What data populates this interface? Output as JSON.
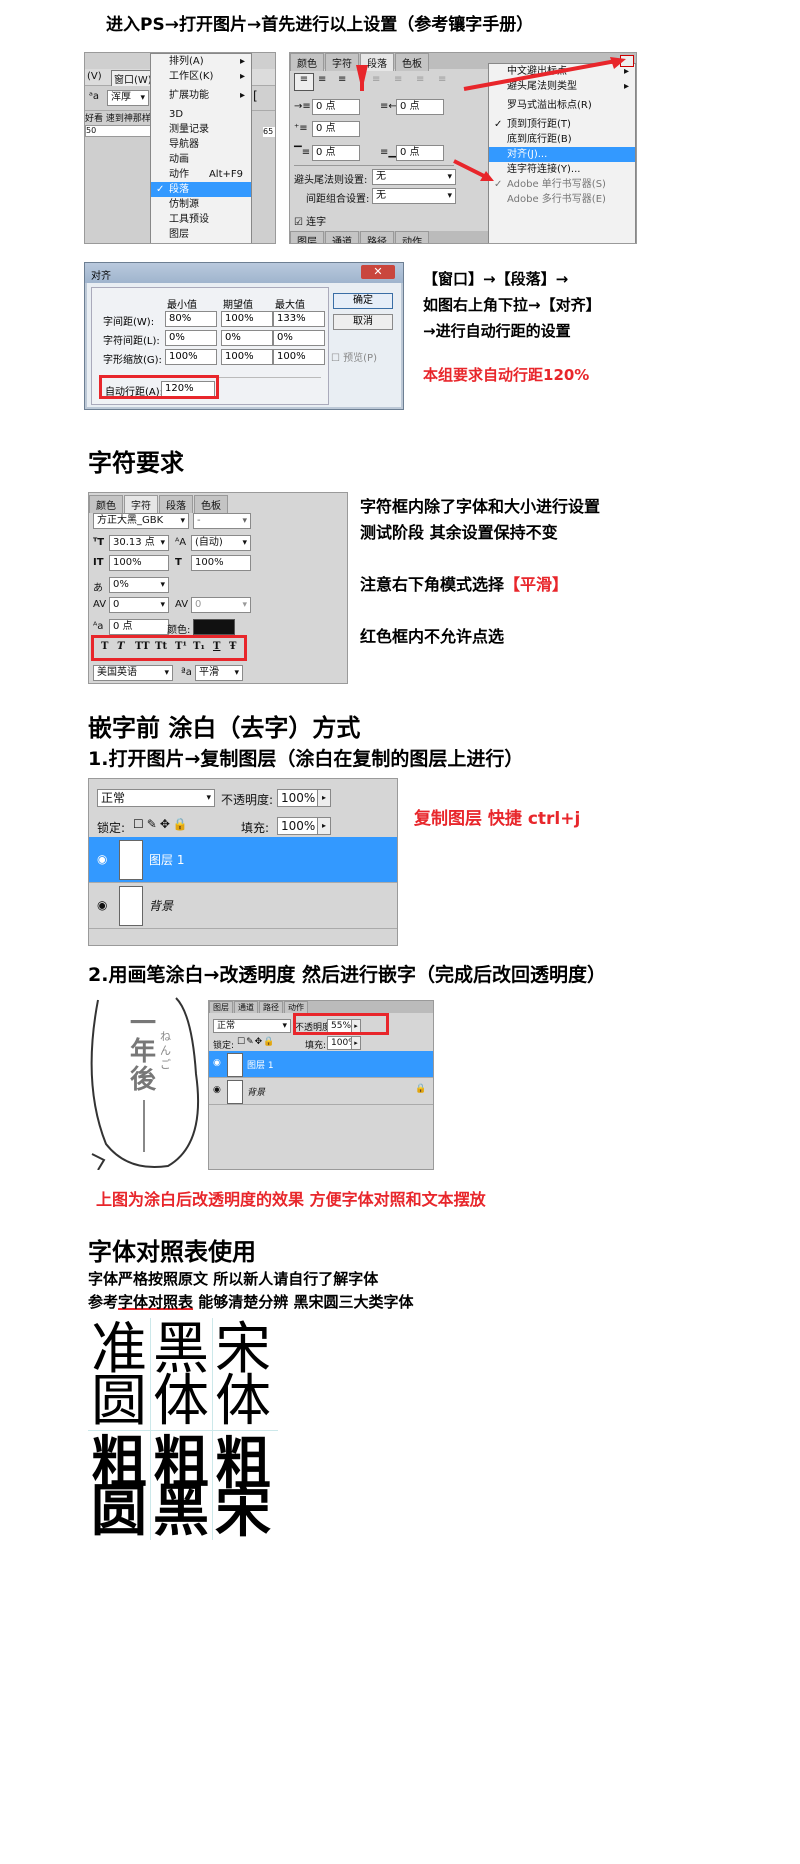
{
  "heading_top": "进入PS→打开图片→首先进行以上设置（参考镶字手册）",
  "ps_window_menu": {
    "menubar": [
      "(V)",
      "窗口(W)"
    ],
    "font_field": "浑厚",
    "ruler_text": "好看 速到神那样",
    "items": [
      {
        "label": "排列(A)",
        "arrow": "▸"
      },
      {
        "label": "工作区(K)",
        "arrow": "▸"
      },
      {
        "label": "扩展功能",
        "arrow": "▸"
      },
      {
        "label": "3D"
      },
      {
        "label": "测量记录"
      },
      {
        "label": "导航器"
      },
      {
        "label": "动画"
      },
      {
        "label": "动作",
        "shortcut": "Alt+F9"
      },
      {
        "label": "段落",
        "check": "✓"
      },
      {
        "label": "仿制源"
      },
      {
        "label": "工具预设"
      },
      {
        "label": "图层"
      }
    ]
  },
  "ps_paragraph_panel": {
    "tabs": [
      "颜色",
      "字符",
      "段落",
      "色板"
    ],
    "fields": [
      "0 点",
      "0 点",
      "0 点",
      "0 点",
      "0 点"
    ],
    "label_punct": "避头尾法则设置:",
    "label_combo": "间距组合设置:",
    "value_none1": "无",
    "value_none2": "无",
    "checkbox": "连字",
    "bottom_tabs": [
      "图层",
      "通道",
      "路径",
      "动作"
    ],
    "menu_items": [
      {
        "label": "中文避出标点",
        "arrow": "▸"
      },
      {
        "label": "避头尾法则类型",
        "arrow": "▸"
      },
      {
        "label": "罗马式溢出标点(R)"
      },
      {
        "label": "顶到顶行距(T)",
        "check": "✓"
      },
      {
        "label": "底到底行距(B)"
      },
      {
        "label": "对齐(J)..."
      },
      {
        "label": "连字符连接(Y)..."
      },
      {
        "label": "Adobe 单行书写器(S)",
        "check": "✓"
      },
      {
        "label": "Adobe 多行书写器(E)"
      }
    ]
  },
  "justify_dialog": {
    "title": "对齐",
    "col_min": "最小值",
    "col_desired": "期望值",
    "col_max": "最大值",
    "rows": [
      {
        "label": "字间距(W):",
        "values": [
          "80%",
          "100%",
          "133%"
        ]
      },
      {
        "label": "字符间距(L):",
        "values": [
          "0%",
          "0%",
          "0%"
        ]
      },
      {
        "label": "字形缩放(G):",
        "values": [
          "100%",
          "100%",
          "100%"
        ]
      }
    ],
    "ok": "确定",
    "cancel": "取消",
    "preview": "预览(P)",
    "auto_leading_label": "自动行距(A):",
    "auto_leading_value": "120%"
  },
  "justify_note": {
    "line1": "【窗口】→【段落】→",
    "line2": "如图右上角下拉→【对齐】",
    "line3": "→进行自动行距的设置",
    "red_line": "本组要求自动行距120%"
  },
  "char_heading": "字符要求",
  "char_panel": {
    "tabs": [
      "颜色",
      "字符",
      "段落",
      "色板"
    ],
    "font": "方正大黑_GBK",
    "style": "-",
    "size": "30.13 点",
    "leading": "(自动)",
    "vscale": "100%",
    "hscale": "100%",
    "tracking": "0%",
    "kern": "0",
    "kern2": "0",
    "baseline": "0 点",
    "color_label": "颜色:",
    "style_buttons": [
      "T",
      "T",
      "TT",
      "Tt",
      "T¹",
      "T₁",
      "T",
      "Ŧ"
    ],
    "language": "美国英语",
    "aa_label": "ªa",
    "aa": "平滑"
  },
  "char_note": {
    "line1": "字符框内除了字体和大小进行设置",
    "line2": "测试阶段 其余设置保持不变",
    "line3_a": "注意右下角模式选择",
    "line3_b": "【平滑】",
    "line4": "红色框内不允许点选"
  },
  "erase_heading": "嵌字前 涂白（去字）方式",
  "step1": "1.打开图片→复制图层（涂白在复制的图层上进行）",
  "layers1": {
    "mode": "正常",
    "opacity_label": "不透明度:",
    "opacity": "100%",
    "lock_label": "锁定:",
    "fill_label": "填充:",
    "fill": "100%",
    "layer1": "图层 1",
    "layer2": "背景"
  },
  "copy_tip": "复制图层 快捷 ctrl+j",
  "step2": "2.用画笔涂白→改透明度 然后进行嵌字（完成后改回透明度）",
  "layers2": {
    "tabs": [
      "图层",
      "通道",
      "路径",
      "动作"
    ],
    "mode": "正常",
    "opacity_label": "不透明度:",
    "opacity": "55%",
    "lock_label": "锁定:",
    "fill_label": "填充:",
    "fill": "100%",
    "layer1": "图层 1",
    "layer2": "背景"
  },
  "bubble_text": {
    "col_main": "一年後",
    "ruby": "ねんご"
  },
  "effect_note": "上图为涂白后改透明度的效果 方便字体对照和文本摆放",
  "font_heading": "字体对照表使用",
  "font_note": {
    "line1": "字体严格按照原文 所以新人请自行了解字体",
    "line2_a": "参考",
    "line2_b": "字体对照表",
    "line2_c": " 能够清楚分辨 黑宋圆三大类字体"
  },
  "font_table": {
    "top": [
      "准",
      "黑",
      "宋",
      "圆",
      "体",
      "体"
    ],
    "bottom": [
      "粗",
      "粗",
      "粗",
      "圆",
      "黑",
      "宋"
    ]
  },
  "colors": {
    "red": "#e8262b",
    "highlight": "#3399ff",
    "panel": "#d6d6d6"
  }
}
